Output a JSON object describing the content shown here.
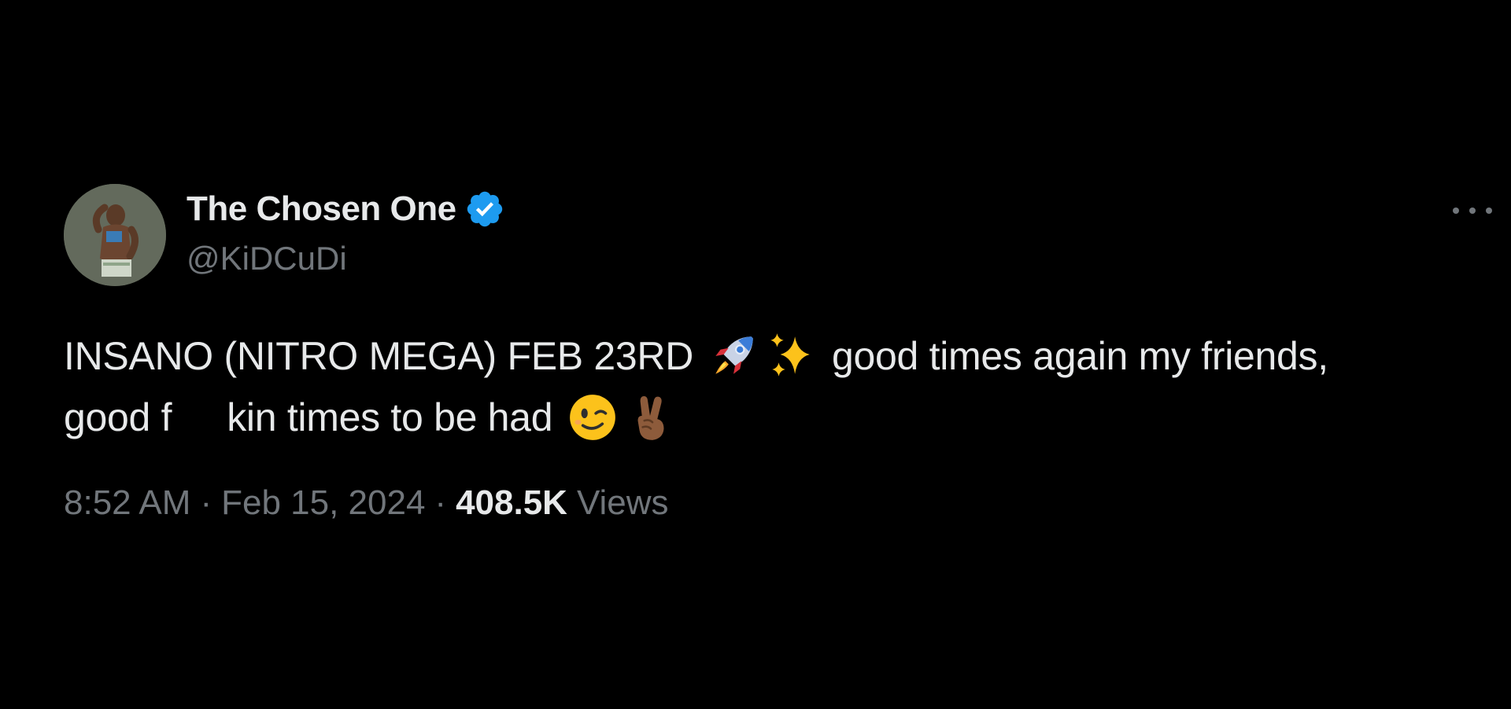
{
  "tweet": {
    "author": {
      "display_name": "The Chosen One",
      "handle": "@KiDCuDi",
      "verified": true,
      "avatar_icon": "user-avatar-photo"
    },
    "more_icon": "ellipsis-icon",
    "text": {
      "line1_part1": "INSANO (NITRO MEGA) FEB 23RD",
      "line1_emojis": [
        "rocket-emoji",
        "sparkles-emoji"
      ],
      "line1_part2": "good times again my friends,",
      "line2_part1": "good f",
      "line2_part2": "kin times to be had",
      "line2_emojis": [
        "winking-face-emoji",
        "victory-hand-emoji"
      ]
    },
    "meta": {
      "time": "8:52 AM",
      "separator": "·",
      "date": "Feb 15, 2024",
      "views_count": "408.5K",
      "views_label": "Views"
    }
  },
  "colors": {
    "background": "#000000",
    "primary_text": "#e7e9ea",
    "secondary_text": "#71767b",
    "verified_badge": "#1d9bf0"
  }
}
